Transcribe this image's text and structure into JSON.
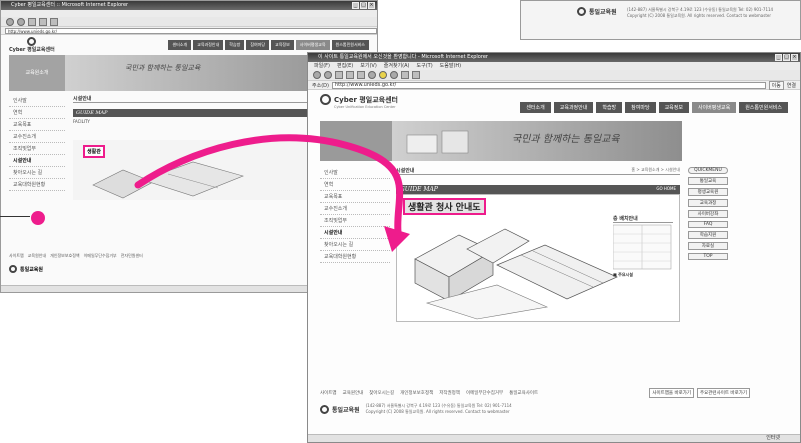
{
  "windows": {
    "small": {
      "title": "Cyber 평일교육센터 :: Microsoft Internet Explorer",
      "address": "http://www.unieds.go.kr/",
      "logo": "Cyber 평일교육센터",
      "nav": [
        "센터소개",
        "교육과정안내",
        "학습방",
        "참여마당",
        "교육정보",
        "사이버평생교육",
        "원스톱민원서비스"
      ],
      "slogan": "국민과 함께하는 통일교육",
      "side_title": "교육원소개",
      "menu": [
        "인사말",
        "연혁",
        "교육목표",
        "교수진소개",
        "조직및업무",
        "시설안내",
        "찾아오시는 길",
        "교육대학원현황"
      ],
      "active_menu": "시설안내",
      "section": "시설안내",
      "guide": "GUIDE MAP",
      "facility": "FACILITY",
      "highlight": "생활관",
      "footer_links": [
        "사이트맵",
        "교육원안내",
        "개인정보보호정책",
        "이메일무단수집거부",
        "전자민원센터"
      ]
    },
    "big": {
      "title": "이 사이트 통일교육원에서 오신것을 환영합니다 - Microsoft Internet Explorer",
      "menu": [
        "파일(F)",
        "편집(E)",
        "보기(V)",
        "즐겨찾기(A)",
        "도구(T)",
        "도움말(H)"
      ],
      "address_label": "주소(D)",
      "address": "http://www.unieds.go.kr/",
      "go": "이동",
      "links": "연결",
      "logo": "Cyber 평일교육센터",
      "logo_sub": "Cyber Unification Education Center",
      "nav": [
        "센터소개",
        "교육과정안내",
        "학습방",
        "참여마당",
        "교육정보",
        "사이버평생교육",
        "원스톱민원서비스"
      ],
      "slogan": "국민과 함께하는 통일교육",
      "menu_left": [
        "인사말",
        "연혁",
        "교육목표",
        "교수진소개",
        "조직및업무",
        "시설안내",
        "찾아오시는 길",
        "교육대학원현황"
      ],
      "active_menu": "시설안내",
      "section": "시설안내",
      "breadcrumb": "홈 > 교육원소개 > 시설안내",
      "guide": "GUIDE MAP",
      "go_home": "GO HOME",
      "highlight": "생활관 청사 안내도",
      "floor_legend_title": "층 배치안내",
      "floor_legend_sub": "■ 주요시설",
      "right_links": [
        "QUICKMENU",
        "통일교육",
        "평생교육원",
        "교육과정",
        "사이버강좌",
        "FAQ",
        "학습지원",
        "자료실",
        "TOP"
      ],
      "footer_links": [
        "사이트맵",
        "교육원안내",
        "찾아오시는길",
        "개인정보보호정책",
        "저작권정책",
        "이메일무단수집거부",
        "통일교육사이트"
      ],
      "footer_logo": "통일교육원",
      "select1": "사이트맵을 바로가기",
      "select2": "주요관련사이트 바로가기",
      "copyright": "Copyright (C) 2008 통일교육원. All rights reserved. Contact to webmaster",
      "address_line": "(142-887) 서울특별시 강북구 4.19로 123 (수유동) 통일교육원 Tel: 02) 901-7114",
      "status_zone": "인터넷"
    },
    "topright": {
      "footer_logo": "통일교육원",
      "address_line": "(142-887) 서울특별시 강북구 4.19로 123 (수유동) 통일교육원 Tel: 02) 901-7114",
      "copyright": "Copyright (C) 2008 통일교육원. All rights reserved. Contact to webmaster"
    }
  },
  "colors": {
    "accent": "#ee1c8c",
    "nav": "#555555"
  }
}
